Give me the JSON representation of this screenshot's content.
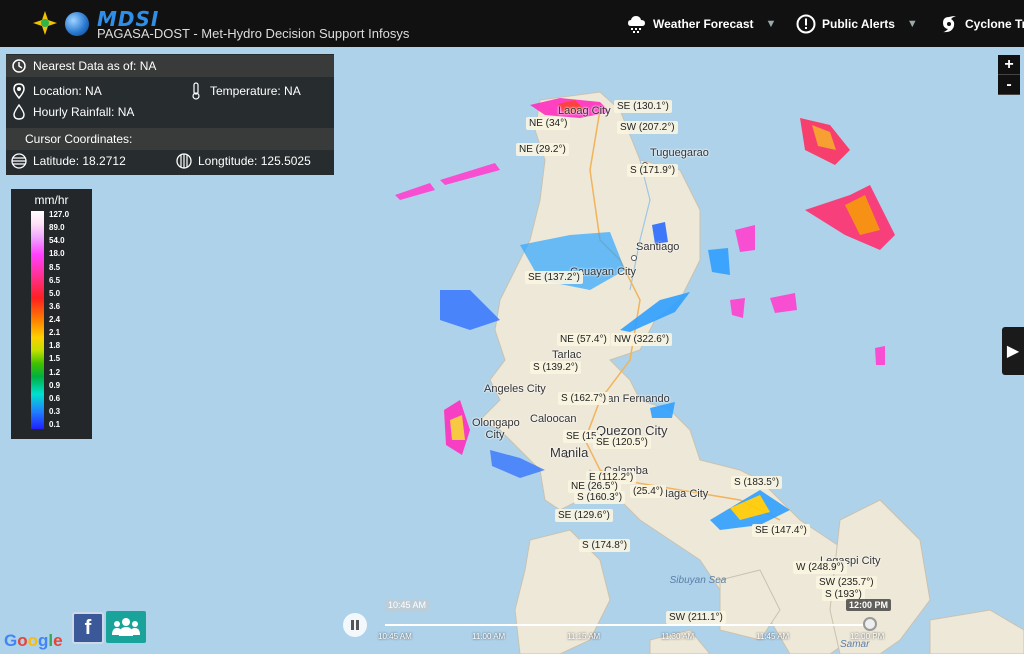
{
  "header": {
    "brand": "MDSI",
    "subtitle": "PAGASA-DOST  - Met-Hydro Decision Support Infosys",
    "nav": [
      {
        "label": "Weather Forecast",
        "icon": "weather-cloud-icon"
      },
      {
        "label": "Public Alerts",
        "icon": "alert-icon"
      },
      {
        "label": "Cyclone Trac",
        "icon": "cyclone-icon"
      }
    ]
  },
  "info_panel": {
    "nearest_label": "Nearest Data as of: NA",
    "location_label": "Location: NA",
    "temperature_label": "Temperature: NA",
    "rainfall_label": "Hourly Rainfall: NA",
    "cursor_label": "Cursor Coordinates:",
    "latitude_label": "Latitude: 18.2712",
    "longitude_label": "Longtitude: 125.5025"
  },
  "legend": {
    "unit": "mm/hr",
    "ticks": [
      "127.0",
      "89.0",
      "54.0",
      "18.0",
      "8.5",
      "6.5",
      "5.0",
      "3.6",
      "2.4",
      "2.1",
      "1.8",
      "1.5",
      "1.2",
      "0.9",
      "0.6",
      "0.3",
      "0.1"
    ]
  },
  "zoom": {
    "in": "+",
    "out": "-"
  },
  "map_labels": {
    "wind": [
      "SE (130.1°)",
      "NE (34°)",
      "SW (207.2°)",
      "NE (29.2°)",
      "S (171.9°)",
      "SE (137.2°)",
      "NE (57.4°)",
      "NW (322.6°)",
      "S (139.2°)",
      "S (162.7°)",
      "SE (15",
      "SE (120.5°)",
      "E (112.2°)",
      "NE (26.5°)",
      "S (160.3°)",
      "SE (129.6°)",
      "(25.4°)",
      "S (183.5°)",
      "SE (147.4°)",
      "S (174.8°)",
      "W (248.9°)",
      "SW (235.7°)",
      "S (193°)",
      "SW (211.1°)"
    ],
    "cities": [
      "Laoag City",
      "Tuguegarao",
      "Santiago",
      "Cauayan City",
      "Tarlac",
      "Angeles City",
      "Olongapo City",
      "Caloocan",
      "San Fernando",
      "Quezon City",
      "Manila",
      "Calamba",
      "Naga City",
      "Legaspi City"
    ],
    "water": [
      "Sibuyan Sea",
      "Samar"
    ]
  },
  "timeline": {
    "start_box": "10:45 AM",
    "end_box": "12:00 PM",
    "ticks": [
      "10:45 AM",
      "11:00 AM",
      "11:15 AM",
      "11:30 AM",
      "11:45 AM",
      "12:00 PM"
    ]
  },
  "footer": {
    "google": "Google",
    "facebook": "f"
  }
}
